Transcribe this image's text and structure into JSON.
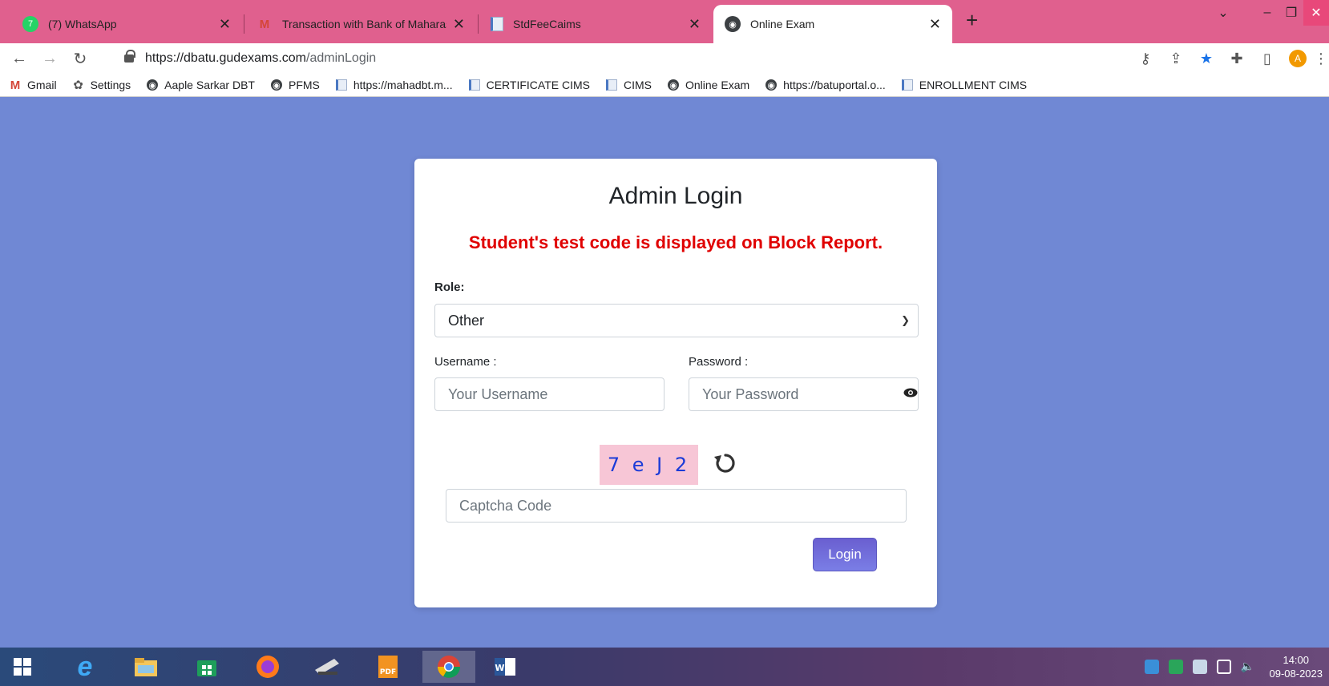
{
  "browser": {
    "tabs": [
      {
        "title": "(7) WhatsApp",
        "icon": "whatsapp-icon",
        "active": false
      },
      {
        "title": "Transaction with Bank of Maharas",
        "icon": "gmail-icon",
        "active": false
      },
      {
        "title": "StdFeeCaims",
        "icon": "document-icon",
        "active": false
      },
      {
        "title": "Online Exam",
        "icon": "globe-icon",
        "active": true
      }
    ],
    "new_tab": "+",
    "url_host": "https://dbatu.gudexams.com",
    "url_path": "/adminLogin",
    "bookmarks": [
      {
        "label": "Gmail",
        "icon": "gmail-icon"
      },
      {
        "label": "Settings",
        "icon": "gear-icon"
      },
      {
        "label": "Aaple Sarkar DBT",
        "icon": "globe-icon"
      },
      {
        "label": "PFMS",
        "icon": "globe-icon"
      },
      {
        "label": "https://mahadbt.m...",
        "icon": "document-icon"
      },
      {
        "label": "CERTIFICATE CIMS",
        "icon": "document-icon"
      },
      {
        "label": "CIMS",
        "icon": "document-icon"
      },
      {
        "label": "Online Exam",
        "icon": "globe-icon"
      },
      {
        "label": "https://batuportal.o...",
        "icon": "globe-icon"
      },
      {
        "label": "ENROLLMENT CIMS",
        "icon": "document-icon"
      }
    ],
    "profile_initial": "A"
  },
  "login": {
    "title": "Admin Login",
    "notice": "Student's test code is displayed on Block Report.",
    "role_label": "Role:",
    "role_value": "Other",
    "username_label": "Username  :",
    "username_placeholder": "Your Username",
    "password_label": "Password  :",
    "password_placeholder": "Your Password",
    "captcha_text": "7 e J 2",
    "captcha_placeholder": "Captcha Code",
    "login_button": "Login"
  },
  "taskbar": {
    "time": "14:00",
    "date": "09-08-2023"
  },
  "colors": {
    "page_bg": "#7088d4",
    "tabstrip_bg": "#e0608e",
    "notice_red": "#e00000",
    "captcha_bg": "#f7c6d6",
    "captcha_text": "#1a3bd8",
    "button_purple": "#6a5fd0"
  }
}
